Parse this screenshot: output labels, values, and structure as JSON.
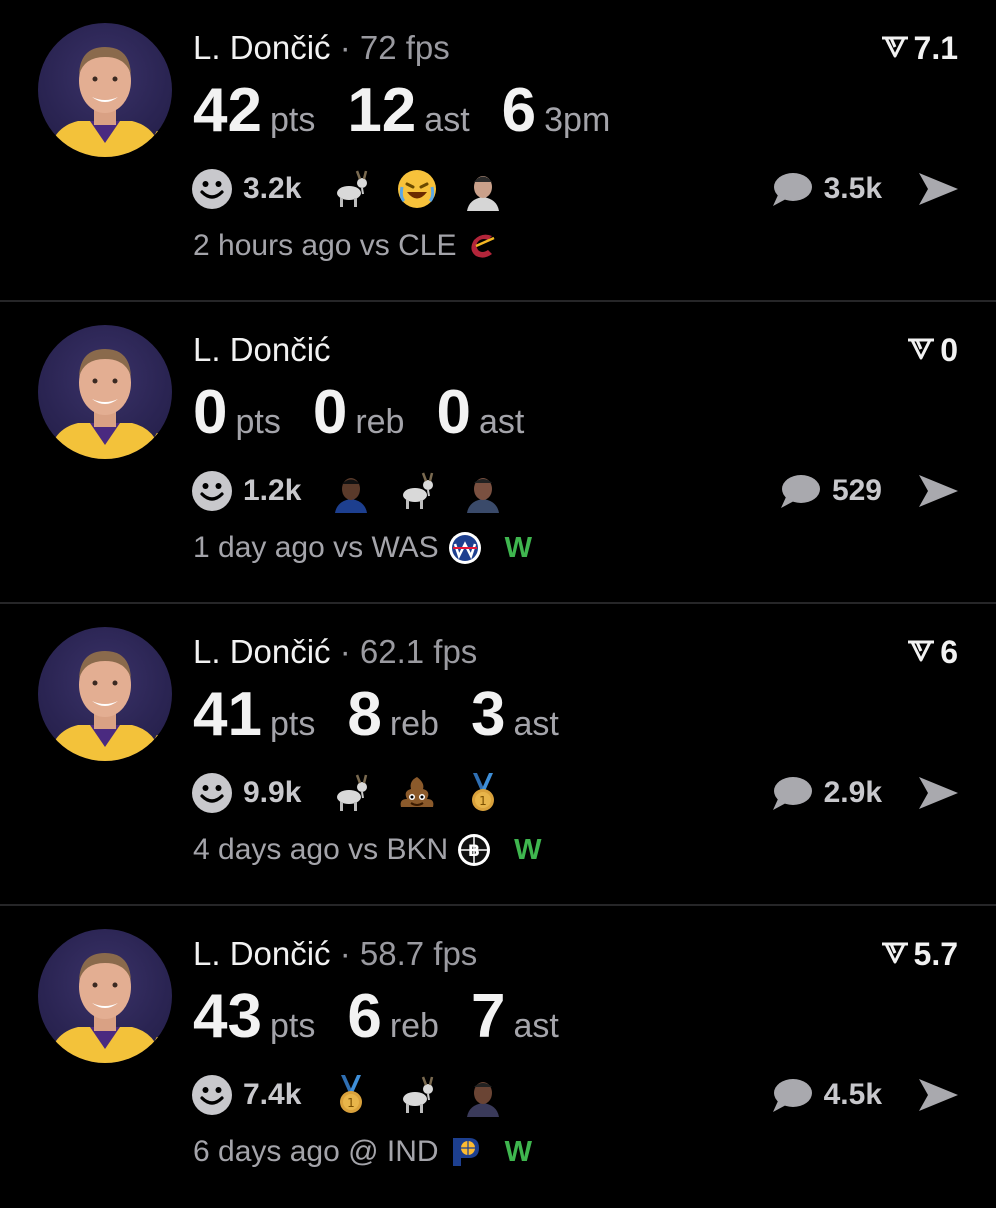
{
  "colors": {
    "background": "#000000",
    "divider": "#262628",
    "win": "#3fb64f",
    "muted": "#a4a4aa"
  },
  "cards": [
    {
      "name": "L. Dončić",
      "fps": "· 72 fps",
      "rating": "7.1",
      "stats": [
        {
          "value": "42",
          "unit": "pts"
        },
        {
          "value": "12",
          "unit": "ast"
        },
        {
          "value": "6",
          "unit": "3pm"
        }
      ],
      "reaction_count": "3.2k",
      "emojis": [
        "goat-emoji",
        "rofl-emoji",
        "player-face-emoji"
      ],
      "comment_count": "3.5k",
      "time": "2 hours ago vs CLE",
      "team_icon": "cavaliers-logo-icon",
      "result": ""
    },
    {
      "name": "L. Dončić",
      "fps": "",
      "rating": "0",
      "stats": [
        {
          "value": "0",
          "unit": "pts"
        },
        {
          "value": "0",
          "unit": "reb"
        },
        {
          "value": "0",
          "unit": "ast"
        }
      ],
      "reaction_count": "1.2k",
      "emojis": [
        "player-face-emoji",
        "goat-emoji",
        "player-face-emoji"
      ],
      "comment_count": "529",
      "time": "1 day ago vs WAS",
      "team_icon": "wizards-logo-icon",
      "result": "W"
    },
    {
      "name": "L. Dončić",
      "fps": "· 62.1 fps",
      "rating": "6",
      "stats": [
        {
          "value": "41",
          "unit": "pts"
        },
        {
          "value": "8",
          "unit": "reb"
        },
        {
          "value": "3",
          "unit": "ast"
        }
      ],
      "reaction_count": "9.9k",
      "emojis": [
        "goat-emoji",
        "poop-emoji",
        "gold-medal-emoji"
      ],
      "comment_count": "2.9k",
      "time": "4 days ago vs BKN",
      "team_icon": "nets-logo-icon",
      "result": "W"
    },
    {
      "name": "L. Dončić",
      "fps": "· 58.7 fps",
      "rating": "5.7",
      "stats": [
        {
          "value": "43",
          "unit": "pts"
        },
        {
          "value": "6",
          "unit": "reb"
        },
        {
          "value": "7",
          "unit": "ast"
        }
      ],
      "reaction_count": "7.4k",
      "emojis": [
        "gold-medal-emoji",
        "goat-emoji",
        "player-face-emoji"
      ],
      "comment_count": "4.5k",
      "time": "6 days ago @ IND",
      "team_icon": "pacers-logo-icon",
      "result": "W"
    }
  ]
}
